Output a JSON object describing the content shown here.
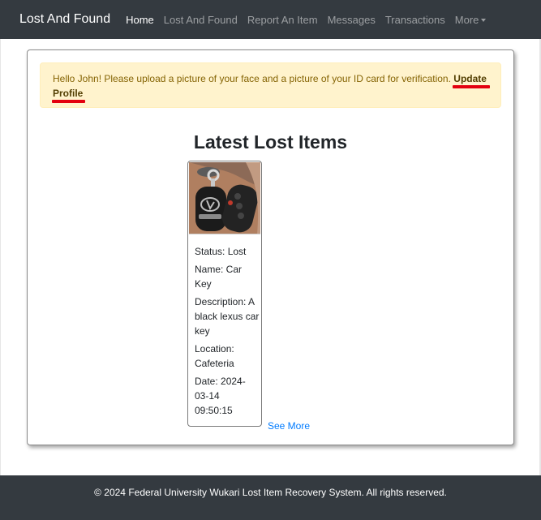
{
  "navbar": {
    "brand": "Lost And Found",
    "links": [
      {
        "label": "Home",
        "active": true
      },
      {
        "label": "Lost And Found"
      },
      {
        "label": "Report An Item"
      },
      {
        "label": "Messages"
      },
      {
        "label": "Transactions"
      }
    ],
    "more_label": "More"
  },
  "alert": {
    "message": "Hello John! Please upload a picture of your face and a picture of your ID card for verification. ",
    "link_label": "Update Profile"
  },
  "section": {
    "heading": "Latest Lost Items"
  },
  "item": {
    "image_icon": "car-key-photo",
    "status": "Status: Lost",
    "name": "Name: Car Key",
    "description": "Description: A black lexus car key",
    "location": "Location: Cafeteria",
    "date": "Date: 2024-03-14 09:50:15"
  },
  "see_more": "See More",
  "footer": {
    "text": "© 2024 Federal University Wukari Lost Item Recovery System. All rights reserved."
  },
  "colors": {
    "navbar_bg": "#343a40",
    "alert_bg": "#fff3cd",
    "alert_text": "#856404",
    "link_blue": "#007bff",
    "annotation_red": "#e3000f"
  }
}
